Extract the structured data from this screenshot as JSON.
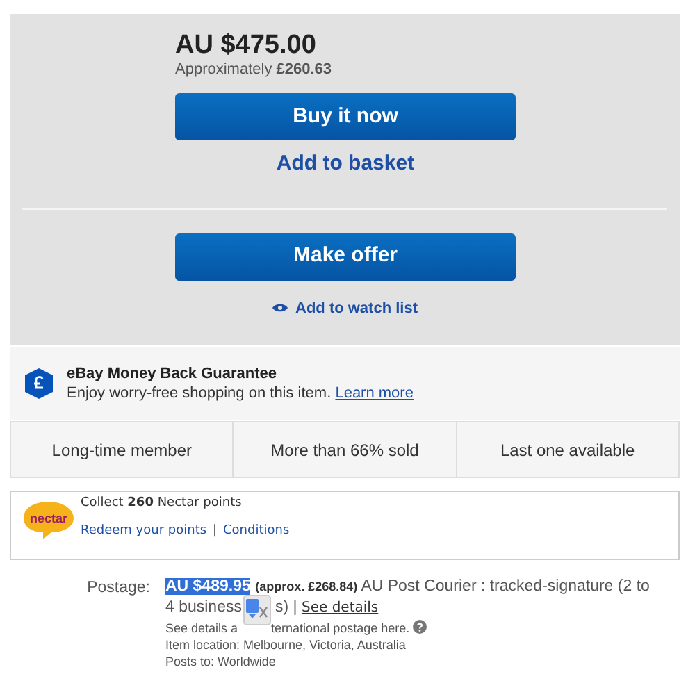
{
  "price": "AU $475.00",
  "approx": "Approximately **£260.63**",
  "buttons": [
    {
      "label": "Buy it now",
      "kind": "primary"
    },
    {
      "label": "Add to basket",
      "kind": "link"
    },
    {
      "label": "Make offer",
      "kind": "primary"
    }
  ],
  "watch": "Add to watch list",
  "guarantee": {
    "title": "eBay Money Back Guarantee",
    "text": "Enjoy worry-free shopping on this item.",
    "link": "Learn more"
  },
  "highlights": [
    "Long-time member",
    "More than 66% sold",
    "Last one available"
  ],
  "nectar": {
    "text": "Collect **260** Nectar points",
    "links": [
      "Redeem your points",
      "Conditions"
    ],
    "separator": "|",
    "logo": "nectar"
  },
  "postage": {
    "label": "Postage:",
    "price": "AU $489.95",
    "approx": "(approx. £268.84)",
    "service": "AU Post Courier : tracked-signature (2 to",
    "service_cont": "4 business",
    "service_end": "s)",
    "separator": "|",
    "details_link": "See details",
    "intl_start": "See details a",
    "intl_end": "ternational postage here.",
    "location": "Item location:  Melbourne, Victoria, Australia",
    "posts_to": "Posts to:  Worldwide"
  }
}
